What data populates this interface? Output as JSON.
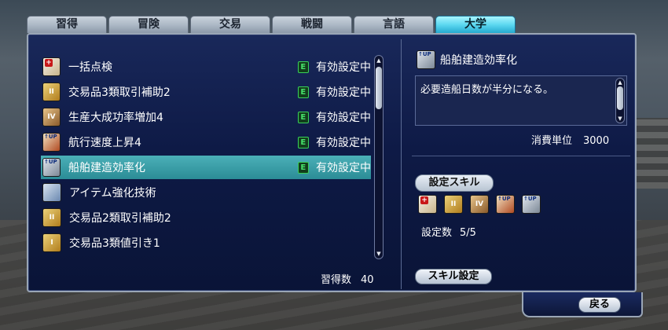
{
  "tabs": [
    {
      "label": "習得"
    },
    {
      "label": "冒険"
    },
    {
      "label": "交易"
    },
    {
      "label": "戦闘"
    },
    {
      "label": "言語"
    },
    {
      "label": "大学"
    }
  ],
  "active_tab": "大学",
  "skill_list": [
    {
      "name": "一括点検",
      "icon": "repair-cross-icon",
      "status": "有効設定中",
      "badge": "E"
    },
    {
      "name": "交易品3類取引補助2",
      "icon": "trade-goods-icon",
      "status": "有効設定中",
      "badge": "E"
    },
    {
      "name": "生産大成功率増加4",
      "icon": "production-bag-icon",
      "status": "有効設定中",
      "badge": "E"
    },
    {
      "name": "航行速度上昇4",
      "icon": "speed-up-icon",
      "status": "有効設定中",
      "badge": "E"
    },
    {
      "name": "船舶建造効率化",
      "icon": "shipbuild-up-icon",
      "status": "有効設定中",
      "badge": "E",
      "selected": true
    },
    {
      "name": "アイテム強化技術",
      "icon": "hammer-icon",
      "status": "",
      "badge": ""
    },
    {
      "name": "交易品2類取引補助2",
      "icon": "trade-goods-icon",
      "status": "",
      "badge": ""
    },
    {
      "name": "交易品3類値引き1",
      "icon": "discount-icon",
      "status": "",
      "badge": ""
    }
  ],
  "learned": {
    "label": "習得数",
    "value": "40"
  },
  "detail": {
    "title": "船舶建造効率化",
    "icon": "shipbuild-up-icon",
    "description": "必要造船日数が半分になる。",
    "consume_label": "消費単位",
    "consume_value": "3000"
  },
  "set_skills": {
    "label": "設定スキル",
    "icons": [
      "repair-cross-icon",
      "trade-goods-icon",
      "production-bag-icon",
      "speed-up-icon",
      "shipbuild-up-icon"
    ],
    "count_label": "設定数",
    "count_value": "5/5"
  },
  "buttons": {
    "skill_set": "スキル設定",
    "back": "戻る"
  },
  "colors": {
    "active_tab": "#5cd8f0",
    "selected_row": "#2b8c96",
    "window_bg": "#0e1a46",
    "badge": "#46e06a"
  }
}
